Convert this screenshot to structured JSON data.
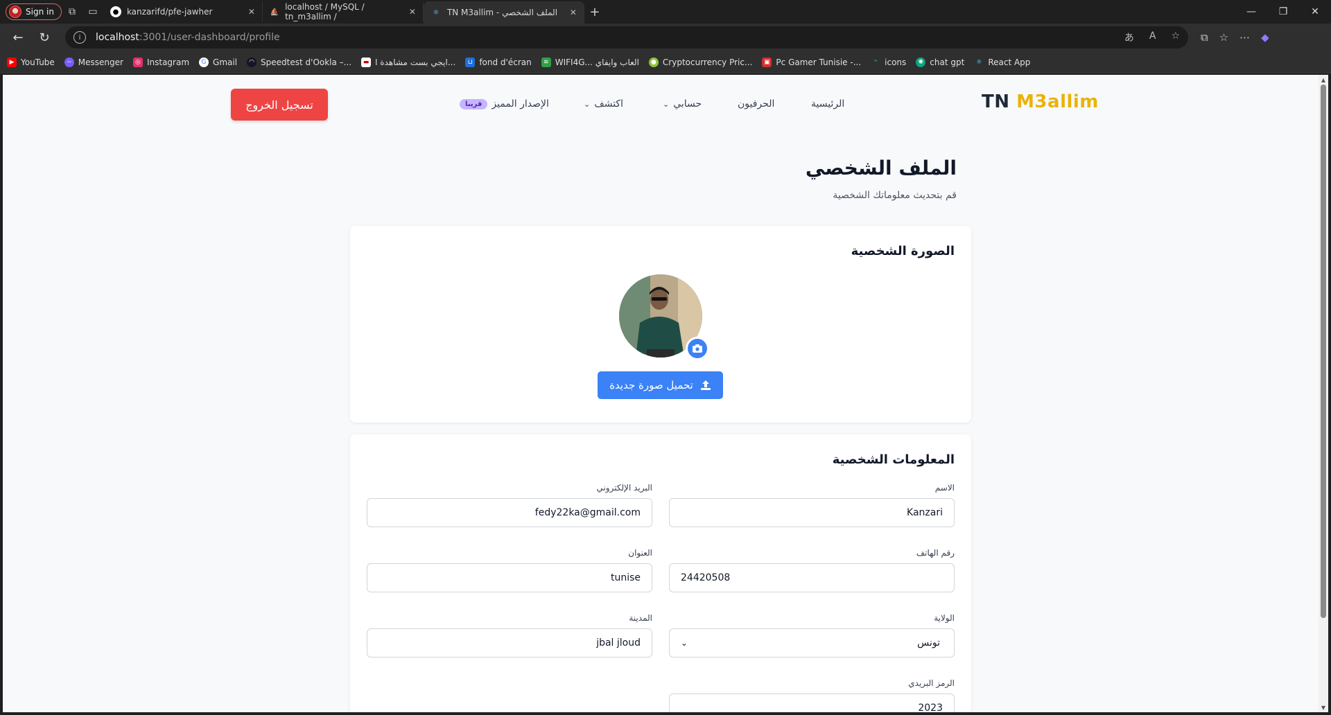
{
  "browser": {
    "profile_label": "Sign in",
    "tabs": [
      {
        "title": "kanzarifd/pfe-jawher",
        "active": false
      },
      {
        "title": "localhost / MySQL / tn_m3allim /",
        "active": false
      },
      {
        "title": "TN M3allim - الملف الشخصي",
        "active": true
      }
    ],
    "url_host": "localhost",
    "url_path": ":3001/user-dashboard/profile",
    "bookmarks": [
      {
        "label": "YouTube",
        "color": "#ff0000"
      },
      {
        "label": "Messenger",
        "color": "#7b5cff"
      },
      {
        "label": "Instagram",
        "color": "#e1306c"
      },
      {
        "label": "Gmail",
        "color": "#ffffff"
      },
      {
        "label": "Speedtest d'Ookla –...",
        "color": "#141526"
      },
      {
        "label": "ايجي بست مشاهدة ا...",
        "color": "#ffffff"
      },
      {
        "label": "fond d'écran",
        "color": "#1e6fd9"
      },
      {
        "label": "WIFI4G... العاب وايفاي",
        "color": "#2ea043"
      },
      {
        "label": "Cryptocurrency Pric...",
        "color": "#8dc63f"
      },
      {
        "label": "Pc Gamer Tunisie -...",
        "color": "#d32f2f"
      },
      {
        "label": "icons",
        "color": "#00b388"
      },
      {
        "label": "chat gpt",
        "color": "#10a37f"
      },
      {
        "label": "React App",
        "color": "#61dafb"
      }
    ]
  },
  "site": {
    "logo_prefix": "TN",
    "logo_brand": "M3allim",
    "nav": {
      "home": "الرئيسية",
      "craftsmen": "الحرفيون",
      "account": "حسابي",
      "discover": "اكتشف",
      "premium": "الإصدار المميز",
      "premium_badge": "قريبا"
    },
    "logout": "تسجيل الخروج"
  },
  "profile": {
    "title": "الملف الشخصي",
    "subtitle": "قم بتحديث معلوماتك الشخصية",
    "photo_section": {
      "title": "الصورة الشخصية",
      "upload_label": "تحميل صورة جديدة"
    },
    "info_section": {
      "title": "المعلومات الشخصية",
      "fields": {
        "name_label": "الاسم",
        "name_value": "Kanzari",
        "email_label": "البريد الإلكتروني",
        "email_value": "fedy22ka@gmail.com",
        "phone_label": "رقم الهاتف",
        "phone_value": "24420508",
        "address_label": "العنوان",
        "address_value": "tunise",
        "state_label": "الولاية",
        "state_value": "تونس",
        "city_label": "المدينة",
        "city_value": "jbal jloud",
        "postal_label": "الرمز البريدي",
        "postal_value": "2023"
      }
    }
  },
  "colors": {
    "brand_yellow": "#eab308",
    "primary_blue": "#3b82f6",
    "danger_red": "#ef4444"
  }
}
